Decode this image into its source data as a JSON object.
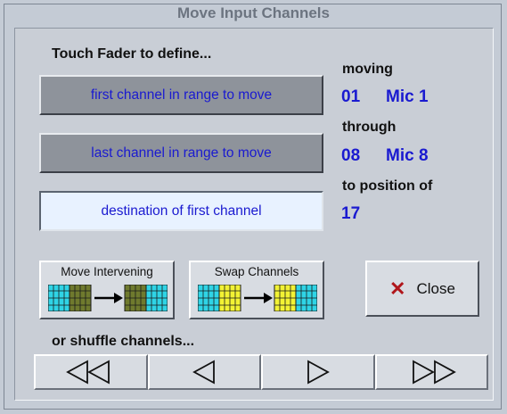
{
  "window": {
    "title": "Move Input Channels"
  },
  "instructions": {
    "touch_fader": "Touch Fader to define...",
    "shuffle": "or shuffle channels..."
  },
  "buttons": {
    "first_channel": "first channel in range to move",
    "last_channel": "last channel in range to move",
    "destination": "destination of first channel",
    "move_intervening": "Move Intervening",
    "swap_channels": "Swap Channels",
    "close": "Close"
  },
  "status": {
    "moving_label": "moving",
    "moving_number": "01",
    "moving_name": "Mic 1",
    "through_label": "through",
    "through_number": "08",
    "through_name": "Mic 8",
    "position_label": "to position of",
    "position_number": "17"
  },
  "shuffle_buttons": [
    "shuffle-far-left",
    "shuffle-left",
    "shuffle-right",
    "shuffle-far-right"
  ],
  "colors": {
    "text_blue": "#1a1ad0",
    "close_x": "#b0161b",
    "cyan": "#2fd4e6",
    "olive": "#6f7a2e",
    "yellow": "#f2f234"
  }
}
